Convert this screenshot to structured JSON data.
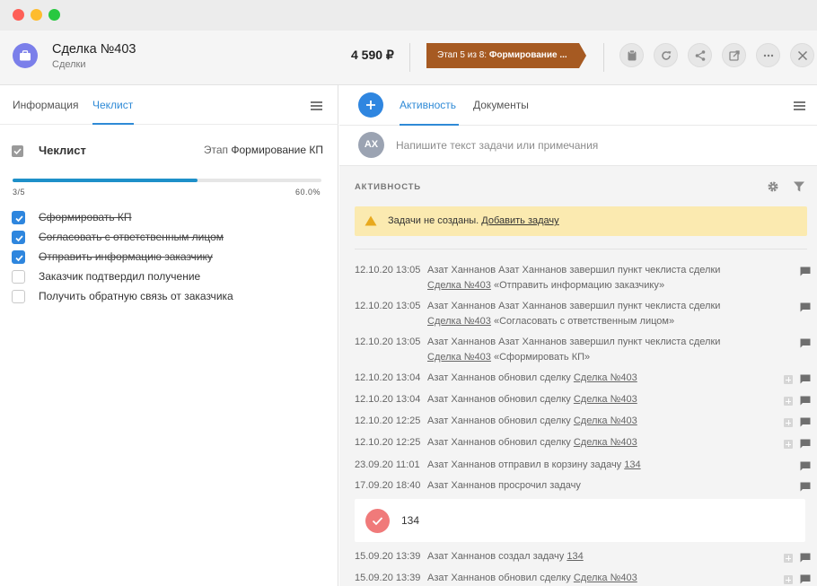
{
  "window": {
    "traffic_lights": [
      "close",
      "minimize",
      "zoom"
    ]
  },
  "header": {
    "title": "Сделка №403",
    "subtitle": "Сделки",
    "price": "4 590 ₽",
    "stage_prefix": "Этап 5 из 8: ",
    "stage_name": "Формирование ...",
    "stage_color": "#a65a22",
    "avatar_color": "#7b7fea",
    "buttons": [
      "clipboard-icon",
      "refresh-icon",
      "share-icon",
      "open-external-icon",
      "more-icon",
      "close-icon"
    ]
  },
  "left": {
    "tabs": [
      {
        "label": "Информация",
        "active": false
      },
      {
        "label": "Чеклист",
        "active": true
      }
    ],
    "checklist": {
      "title": "Чеклист",
      "stage_label": "Этап",
      "stage_value": "Формирование КП",
      "count": "3/5",
      "percent": "60.0%",
      "progress": 0.6,
      "items": [
        {
          "label": "Сформировать КП",
          "checked": true
        },
        {
          "label": "Согласовать с ответственным лицом",
          "checked": true
        },
        {
          "label": "Отправить информацию заказчику",
          "checked": true
        },
        {
          "label": "Заказчик подтвердил получение",
          "checked": false
        },
        {
          "label": "Получить обратную связь от заказчика",
          "checked": false
        }
      ]
    }
  },
  "right": {
    "tabs": [
      {
        "label": "Активность",
        "active": true
      },
      {
        "label": "Документы",
        "active": false
      }
    ],
    "composer": {
      "avatar": "АХ",
      "placeholder": "Напишите текст задачи или примечания"
    },
    "activity_heading": "АКТИВНОСТЬ",
    "alert": {
      "text": "Задачи не созданы.",
      "link": "Добавить задачу"
    },
    "events": [
      {
        "date": "12.10.20 13:05",
        "pre": "Азат Ханнанов Азат Ханнанов завершил пункт чеклиста сделки",
        "link": "Сделка №403",
        "post": "«Отправить информацию заказчику»",
        "expand": false
      },
      {
        "date": "12.10.20 13:05",
        "pre": "Азат Ханнанов Азат Ханнанов завершил пункт чеклиста сделки",
        "link": "Сделка №403",
        "post": "«Согласовать с ответственным лицом»",
        "expand": false
      },
      {
        "date": "12.10.20 13:05",
        "pre": "Азат Ханнанов Азат Ханнанов завершил пункт чеклиста сделки",
        "link": "Сделка №403",
        "post": "«Сформировать КП»",
        "expand": false
      },
      {
        "date": "12.10.20 13:04",
        "pre": "Азат Ханнанов обновил сделку",
        "link": "Сделка №403",
        "post": "",
        "expand": true
      },
      {
        "date": "12.10.20 13:04",
        "pre": "Азат Ханнанов обновил сделку",
        "link": "Сделка №403",
        "post": "",
        "expand": true
      },
      {
        "date": "12.10.20 12:25",
        "pre": "Азат Ханнанов обновил сделку",
        "link": "Сделка №403",
        "post": "",
        "expand": true
      },
      {
        "date": "12.10.20 12:25",
        "pre": "Азат Ханнанов обновил сделку",
        "link": "Сделка №403",
        "post": "",
        "expand": true
      },
      {
        "date": "23.09.20 11:01",
        "pre": "Азат Ханнанов отправил в корзину задачу",
        "link": "134",
        "post": "",
        "expand": false
      },
      {
        "date": "17.09.20 18:40",
        "pre": "Азат Ханнанов просрочил задачу",
        "link": "",
        "post": "",
        "expand": false
      }
    ],
    "task_card": {
      "number": "134",
      "check_color": "#f07a7a"
    },
    "events_after": [
      {
        "date": "15.09.20 13:39",
        "pre": "Азат Ханнанов создал задачу",
        "link": "134",
        "post": "",
        "expand": true
      },
      {
        "date": "15.09.20 13:39",
        "pre": "Азат Ханнанов обновил сделку",
        "link": "Сделка №403",
        "post": "",
        "expand": true
      }
    ]
  }
}
